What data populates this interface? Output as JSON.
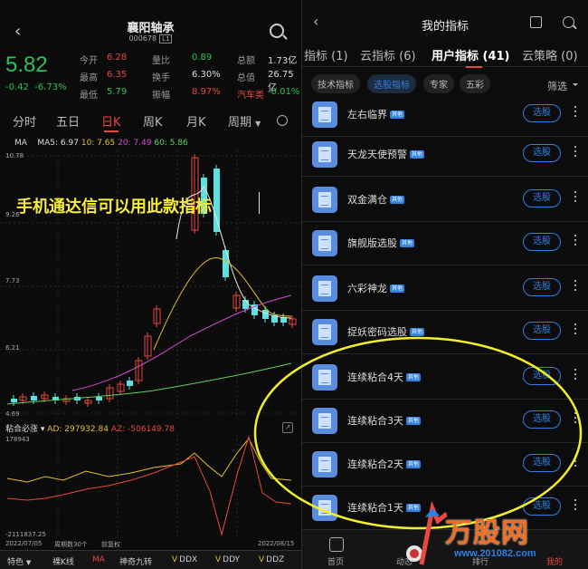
{
  "left": {
    "title": "襄阳轴承",
    "code": "000678",
    "code_tag": "L1",
    "price": "5.82",
    "change": "-0.42",
    "change_pct": "-6.73%",
    "quotes": [
      {
        "label": "今开",
        "value": "6.28",
        "color": "red"
      },
      {
        "label": "量比",
        "value": "0.89",
        "color": "grn"
      },
      {
        "label": "总额",
        "value": "1.73亿",
        "color": "wht"
      },
      {
        "label": "最高",
        "value": "6.35",
        "color": "red"
      },
      {
        "label": "换手",
        "value": "6.30%",
        "color": "wht"
      },
      {
        "label": "总值",
        "value": "26.75亿",
        "color": "wht"
      },
      {
        "label": "最低",
        "value": "5.79",
        "color": "grn"
      },
      {
        "label": "振幅",
        "value": "8.97%",
        "color": "red"
      },
      {
        "label": "汽车类",
        "value": "-0.01%",
        "color": "grn"
      }
    ],
    "tabs": [
      "分时",
      "五日",
      "日K",
      "周K",
      "月K",
      "周期"
    ],
    "active_tab": "日K",
    "ma": {
      "label": "MA",
      "ma5": "MA5: 6.97",
      "ma10": "10: 7.65",
      "ma20": "20: 7.49",
      "ma60": "60: 5.86"
    },
    "y_labels": [
      "10.78",
      "9.26",
      "7.73",
      "6.21",
      "4.69"
    ],
    "caption": "手机通达信可以用此款指标",
    "indicator": {
      "name": "粘合必涨",
      "ad": "AD: 297932.84",
      "az": "AZ: -506149.78",
      "top": "178943",
      "bottom": "-2111837.25"
    },
    "dates": {
      "start": "2022/07/05",
      "count": "周期数30个",
      "rights": "前复权",
      "end": "2022/08/15"
    },
    "bottom_bar": [
      "特色",
      "裸K线",
      "MA",
      "神奇九转",
      "DDX",
      "DDY",
      "DDZ"
    ]
  },
  "right": {
    "title": "我的指标",
    "tabs": [
      "指标 (1)",
      "云指标 (6)",
      "用户指标 (41)",
      "云策略 (0)"
    ],
    "active_tab": "用户指标 (41)",
    "chips": [
      "技术指标",
      "选股指标",
      "专家",
      "五彩"
    ],
    "active_chip": "选股指标",
    "filter": "筛选",
    "tag": "其他",
    "select_label": "选股",
    "items": [
      "左右临界",
      "天龙天使预警",
      "双金满仓",
      "旗舰版选股",
      "六彩神龙",
      "捉妖密码选股",
      "连续粘合4天",
      "连续粘合3天",
      "连续粘合2天",
      "连续粘合1天"
    ],
    "bottom_nav": [
      "首页",
      "动态",
      "排行",
      "我的"
    ]
  },
  "watermark": {
    "name": "万股网",
    "url": "www.201082.com"
  },
  "colors": {
    "up": "#e8483f",
    "down": "#2dc05a",
    "accent": "#2f80e0",
    "caption": "#f6ec3a"
  }
}
